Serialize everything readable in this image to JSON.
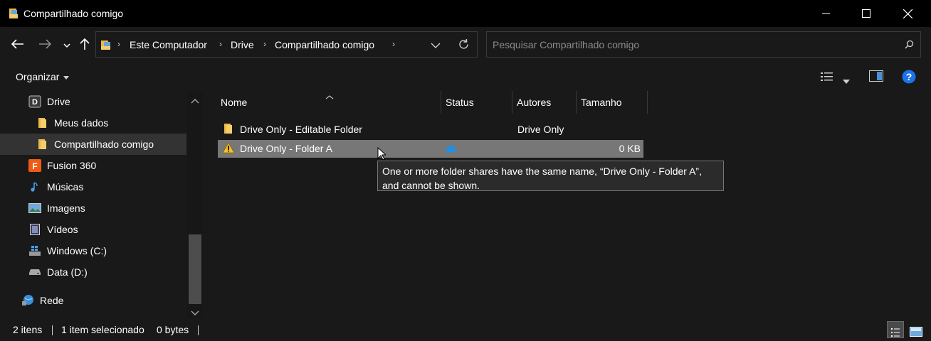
{
  "window": {
    "title": "Compartilhado comigo"
  },
  "nav": {
    "back_icon": "back-arrow-icon",
    "forward_icon": "forward-arrow-icon",
    "recent_icon": "chevron-down-icon",
    "up_icon": "up-arrow-icon"
  },
  "address": {
    "crumbs": [
      "Este Computador",
      "Drive",
      "Compartilhado comigo"
    ]
  },
  "search": {
    "placeholder": "Pesquisar Compartilhado comigo"
  },
  "commandbar": {
    "organize_label": "Organizar"
  },
  "sidebar": {
    "items": [
      {
        "label": "Drive",
        "icon": "drive-app-icon"
      },
      {
        "label": "Meus dados",
        "icon": "folder-icon"
      },
      {
        "label": "Compartilhado comigo",
        "icon": "shared-folder-icon"
      },
      {
        "label": "Fusion 360",
        "icon": "fusion-app-icon"
      },
      {
        "label": "Músicas",
        "icon": "music-icon"
      },
      {
        "label": "Imagens",
        "icon": "pictures-icon"
      },
      {
        "label": "Vídeos",
        "icon": "videos-icon"
      },
      {
        "label": "Windows (C:)",
        "icon": "windows-drive-icon"
      },
      {
        "label": "Data (D:)",
        "icon": "disk-drive-icon"
      },
      {
        "label": "Rede",
        "icon": "network-icon"
      }
    ]
  },
  "columns": {
    "name": "Nome",
    "status": "Status",
    "authors": "Autores",
    "size": "Tamanho"
  },
  "files": [
    {
      "name": "Drive Only - Editable Folder",
      "status": "",
      "authors": "Drive Only",
      "size": "",
      "icon": "folder-icon"
    },
    {
      "name": "Drive Only - Folder A",
      "status": "cloud",
      "authors": "",
      "size": "0 KB",
      "icon": "warning-icon"
    }
  ],
  "tooltip": {
    "line1": "One or more folder shares have the same name, “Drive Only - Folder A”,",
    "line2": "and cannot be shown."
  },
  "status": {
    "item_count": "2 itens",
    "selected": "1 item selecionado",
    "selected_size": "0 bytes"
  },
  "colors": {
    "background": "#191919",
    "titlebar": "#000000",
    "selection": "#777777",
    "accent": "#0078d7",
    "folder": "#e8b94a"
  }
}
